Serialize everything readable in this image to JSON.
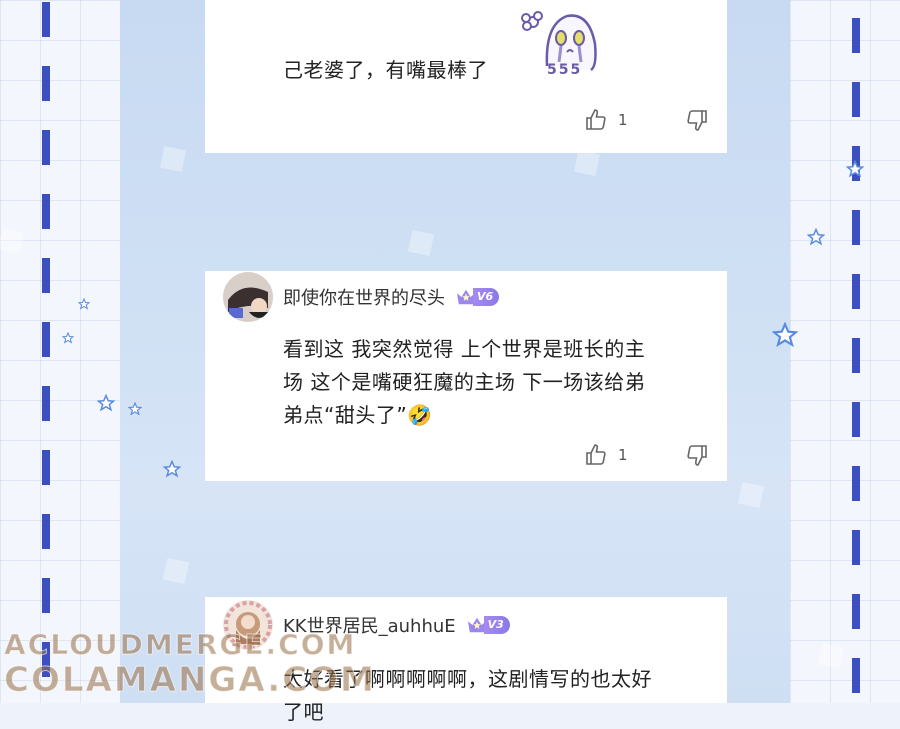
{
  "comments": [
    {
      "text_lines": [
        "己老婆了，有嘴最棒了"
      ],
      "sticker_text": "555",
      "likes": "1"
    },
    {
      "username": "即使你在世界的尽头",
      "level": "V6",
      "text_lines": [
        "看到这 我突然觉得 上个世界是班长的主",
        "场 这个是嘴硬狂魔的主场 下一场该给弟",
        "弟点“甜头了”🤣"
      ],
      "likes": "1"
    },
    {
      "username": "KK世界居民_auhhuE",
      "level": "V3",
      "text_lines": [
        "太好看了啊啊啊啊啊，这剧情写的也太好",
        "了吧"
      ]
    }
  ],
  "watermark": {
    "line1": "ACLOUDMERGE.COM",
    "line2": "COLAMANGA.COM"
  },
  "icons": [
    "thumbs-up-icon",
    "thumbs-down-icon",
    "crown-icon",
    "star-icon"
  ],
  "colors": {
    "accent": "#3d4fbf",
    "badge": "#9b86ee"
  }
}
